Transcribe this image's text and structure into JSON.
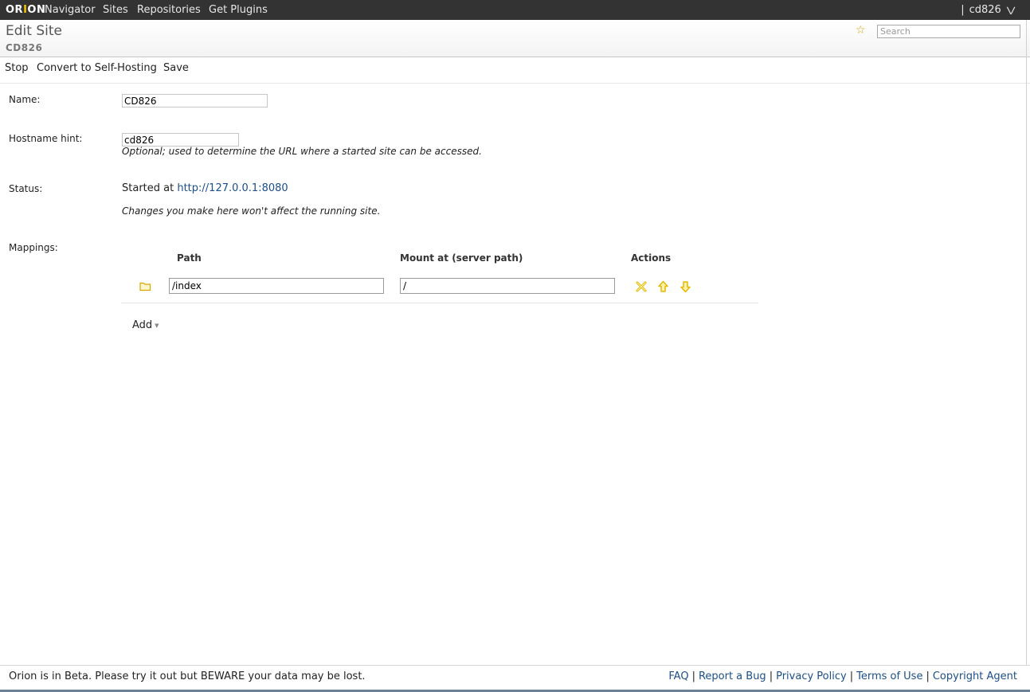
{
  "topbar": {
    "logo_prefix": "OR",
    "logo_o": "I",
    "logo_suffix": "ON",
    "nav": [
      "Navigator",
      "Sites",
      "Repositories",
      "Get Plugins"
    ],
    "separator": "|",
    "user": "cd826",
    "user_menu_icon": "double-chevron-down-icon"
  },
  "header": {
    "title": "Edit Site",
    "subtitle": "CD826",
    "favorite_icon": "star-icon",
    "search_placeholder": "Search"
  },
  "toolbar": {
    "stop": "Stop",
    "convert": "Convert to Self-Hosting",
    "save": "Save"
  },
  "form": {
    "name_label": "Name:",
    "name_value": "CD826",
    "hostname_label": "Hostname hint:",
    "hostname_value": "cd826",
    "hostname_hint": "Optional; used to determine the URL where a started site can be accessed.",
    "status_label": "Status:",
    "status_prefix": "Started at",
    "status_url": "http://127.0.0.1:8080",
    "status_note": "Changes you make here won't affect the running site.",
    "mappings_label": "Mappings:"
  },
  "mappings": {
    "columns": [
      "Path",
      "Mount at (server path)",
      "Actions"
    ],
    "rows": [
      {
        "path": "/index",
        "mount": "/",
        "icon": "folder-icon",
        "actions": [
          "delete-icon",
          "move-up-icon",
          "move-down-icon"
        ]
      }
    ],
    "add_label": "Add"
  },
  "footer": {
    "beta_text": "Orion is in Beta. Please try it out but BEWARE your data may be lost.",
    "links": [
      "FAQ",
      "Report a Bug",
      "Privacy Policy",
      "Terms of Use",
      "Copyright Agent"
    ],
    "separator": "|"
  },
  "colors": {
    "topbar_bg": "#333333",
    "link": "#1b4f8a",
    "accent_icons": "#e6b800"
  }
}
